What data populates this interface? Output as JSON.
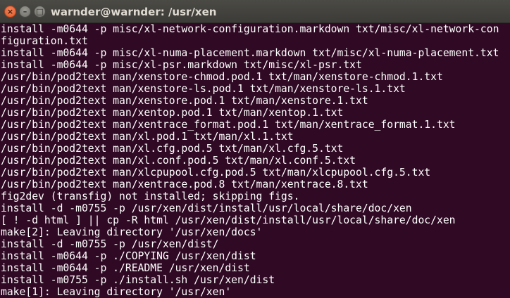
{
  "window": {
    "title": "warnder@warnder: /usr/xen",
    "close_glyph": "×",
    "minimize_glyph": "–",
    "maximize_glyph": "□",
    "colors": {
      "background": "#300a24",
      "foreground": "#ffffff",
      "titlebar": "#3c3b37",
      "close_button": "#e9653a"
    }
  },
  "terminal": {
    "lines": [
      "install -m0644 -p misc/xl-network-configuration.markdown txt/misc/xl-network-con",
      "figuration.txt",
      "install -m0644 -p misc/xl-numa-placement.markdown txt/misc/xl-numa-placement.txt",
      "install -m0644 -p misc/xl-psr.markdown txt/misc/xl-psr.txt",
      "/usr/bin/pod2text man/xenstore-chmod.pod.1 txt/man/xenstore-chmod.1.txt",
      "/usr/bin/pod2text man/xenstore-ls.pod.1 txt/man/xenstore-ls.1.txt",
      "/usr/bin/pod2text man/xenstore.pod.1 txt/man/xenstore.1.txt",
      "/usr/bin/pod2text man/xentop.pod.1 txt/man/xentop.1.txt",
      "/usr/bin/pod2text man/xentrace_format.pod.1 txt/man/xentrace_format.1.txt",
      "/usr/bin/pod2text man/xl.pod.1 txt/man/xl.1.txt",
      "/usr/bin/pod2text man/xl.cfg.pod.5 txt/man/xl.cfg.5.txt",
      "/usr/bin/pod2text man/xl.conf.pod.5 txt/man/xl.conf.5.txt",
      "/usr/bin/pod2text man/xlcpupool.cfg.pod.5 txt/man/xlcpupool.cfg.5.txt",
      "/usr/bin/pod2text man/xentrace.pod.8 txt/man/xentrace.8.txt",
      "fig2dev (transfig) not installed; skipping figs.",
      "install -d -m0755 -p /usr/xen/dist/install/usr/local/share/doc/xen",
      "[ ! -d html ] || cp -R html /usr/xen/dist/install/usr/local/share/doc/xen",
      "make[2]: Leaving directory '/usr/xen/docs'",
      "install -d -m0755 -p /usr/xen/dist/",
      "install -m0644 -p ./COPYING /usr/xen/dist",
      "install -m0644 -p ./README /usr/xen/dist",
      "install -m0755 -p ./install.sh /usr/xen/dist",
      "make[1]: Leaving directory '/usr/xen'"
    ]
  }
}
